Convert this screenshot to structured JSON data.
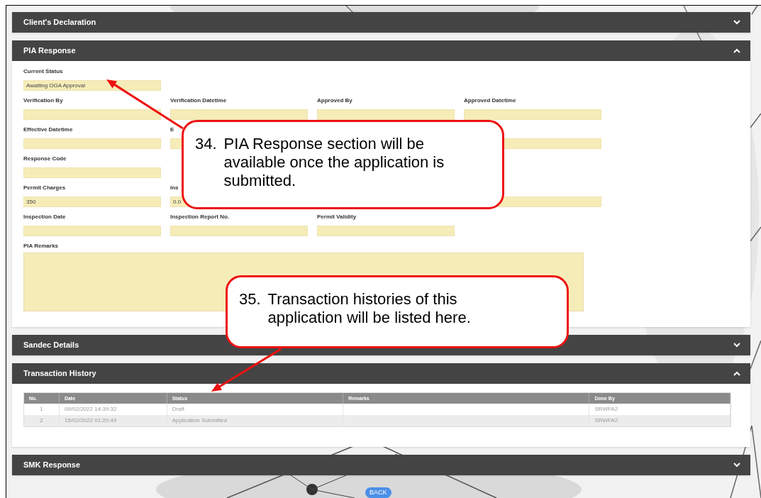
{
  "sections": [
    {
      "title": "Client's Declaration",
      "expanded": false
    },
    {
      "title": "PIA Response",
      "expanded": true,
      "kind": "form",
      "rows": [
        [
          {
            "kind": "field",
            "label": "Current Status",
            "value": "Awaiting OGA Approval"
          }
        ],
        [
          {
            "kind": "field",
            "label": "Verification By"
          },
          {
            "kind": "field",
            "label": "Verification Datetime"
          },
          {
            "kind": "field",
            "label": "Approved By"
          },
          {
            "kind": "field",
            "label": "Approved Datetime"
          }
        ],
        [
          {
            "kind": "field",
            "label": "Effective Datetime"
          },
          {
            "kind": "field",
            "label": "E"
          },
          {
            "kind": "gap"
          },
          {
            "kind": "field"
          }
        ],
        [
          {
            "kind": "field",
            "label": "Response Code"
          }
        ],
        [
          {
            "kind": "field",
            "label": "Permit Charges",
            "value": "350"
          },
          {
            "kind": "field",
            "label": "Ins",
            "value": "0.0"
          },
          {
            "kind": "gap"
          },
          {
            "kind": "field"
          }
        ],
        [
          {
            "kind": "field",
            "label": "Inspection Date"
          },
          {
            "kind": "field",
            "label": "Inspection Report No."
          },
          {
            "kind": "field",
            "label": "Permit Validity"
          }
        ]
      ],
      "remarks_label": "PIA Remarks"
    },
    {
      "title": "Sandec Details",
      "expanded": false
    },
    {
      "title": "Transaction History",
      "expanded": true,
      "kind": "table",
      "columns": [
        "No.",
        "Date",
        "Status",
        "Remarks",
        "Done By"
      ],
      "rows": [
        [
          "1",
          "09/02/2022 14:39:32",
          "Draft",
          "",
          "SRWFA2"
        ],
        [
          "2",
          "15/02/2022 01:20:49",
          "Application Submitted",
          "",
          "SRWFA2"
        ]
      ]
    },
    {
      "title": "SMK Response",
      "expanded": false
    }
  ],
  "back_button": "BACK",
  "callouts": [
    {
      "number": "34.",
      "text": "PIA Response section will be available once the application is submitted."
    },
    {
      "number": "35.",
      "text": "Transaction histories of this application will be listed here."
    }
  ]
}
